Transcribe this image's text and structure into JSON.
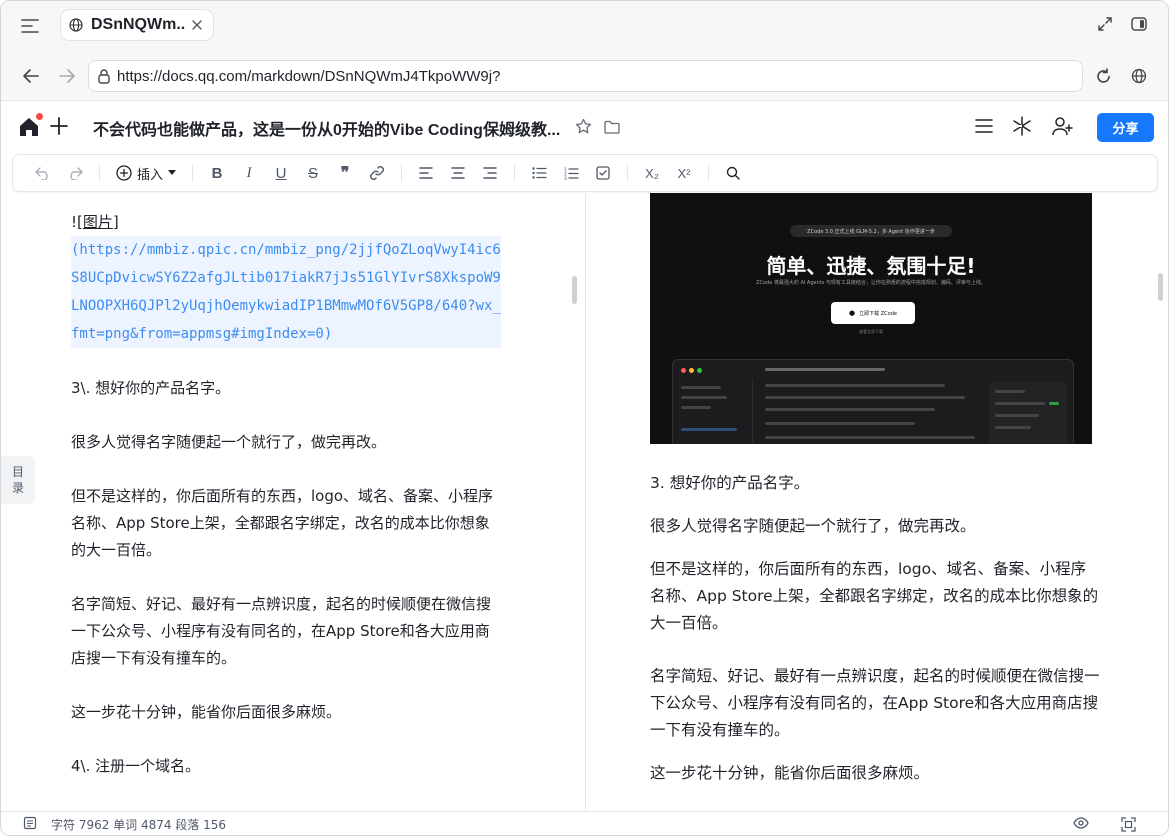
{
  "browser": {
    "tab_title": "DSnNQWm...",
    "url": "https://docs.qq.com/markdown/DSnNQWmJ4TkpoWW9j?"
  },
  "doc": {
    "title": "不会代码也能做产品，这是一份从0开始的Vibe Coding保姆级教...",
    "share_label": "分享"
  },
  "toolbar": {
    "insert_label": "插入",
    "bold": "B",
    "italic": "I",
    "underline": "U",
    "strike": "S",
    "quote": "❞",
    "subscript": "X₂",
    "superscript": "X²"
  },
  "toc": {
    "label1": "目",
    "label2": "录"
  },
  "editor": {
    "image_prefix": "![",
    "image_word": "图片",
    "image_suffix": "]",
    "image_url": "(https://mmbiz.qpic.cn/mmbiz_png/2jjfQoZLoqVwyI4ic6S8UCpDvicwSY6Z2afgJLtib017iakR7jJs51GlYIvrS8XkspoW9LNOOPXH6QJPl2yUqjhOemykwiadIP1BMmwMOf6V5GP8/640?wx_fmt=png&from=appmsg#imgIndex=0)",
    "p1": "3\\. 想好你的产品名字。",
    "p2": "很多人觉得名字随便起一个就行了，做完再改。",
    "p3": "但不是这样的，你后面所有的东西，logo、域名、备案、小程序名称、App Store上架，全都跟名字绑定，改名的成本比你想象的大一百倍。",
    "p4": "名字简短、好记、最好有一点辨识度，起名的时候顺便在微信搜一下公众号、小程序有没有同名的，在App Store和各大应用商店搜一下有没有撞车的。",
    "p5": "这一步花十分钟，能省你后面很多麻烦。",
    "p6": "4\\. 注册一个域名。"
  },
  "preview": {
    "image": {
      "badge": "ZCode 3.0 正式上线 GLM-5.2，多 Agent 协作更进一步",
      "headline": "简单、迅捷、氛围十足!",
      "sub": "ZCode 将最强大的 AI Agents 与现有工具链结合，让你在熟悉的流程中完成规划、编码、评审与上线。",
      "button": "立即下载 ZCode",
      "note": "查看全部下载"
    },
    "p1": "3. 想好你的产品名字。",
    "p2": "很多人觉得名字随便起一个就行了，做完再改。",
    "p3": "但不是这样的，你后面所有的东西，logo、域名、备案、小程序名称、App Store上架，全都跟名字绑定，改名的成本比你想象的大一百倍。",
    "p4": "名字简短、好记、最好有一点辨识度，起名的时候顺便在微信搜一下公众号、小程序有没有同名的，在App Store和各大应用商店搜一下有没有撞车的。",
    "p5": "这一步花十分钟，能省你后面很多麻烦。"
  },
  "status": {
    "text": "字符 7962 单词 4874 段落 156"
  },
  "colors": {
    "accent": "#1677ff",
    "link": "#3c8df0",
    "notify": "#f54a45"
  }
}
